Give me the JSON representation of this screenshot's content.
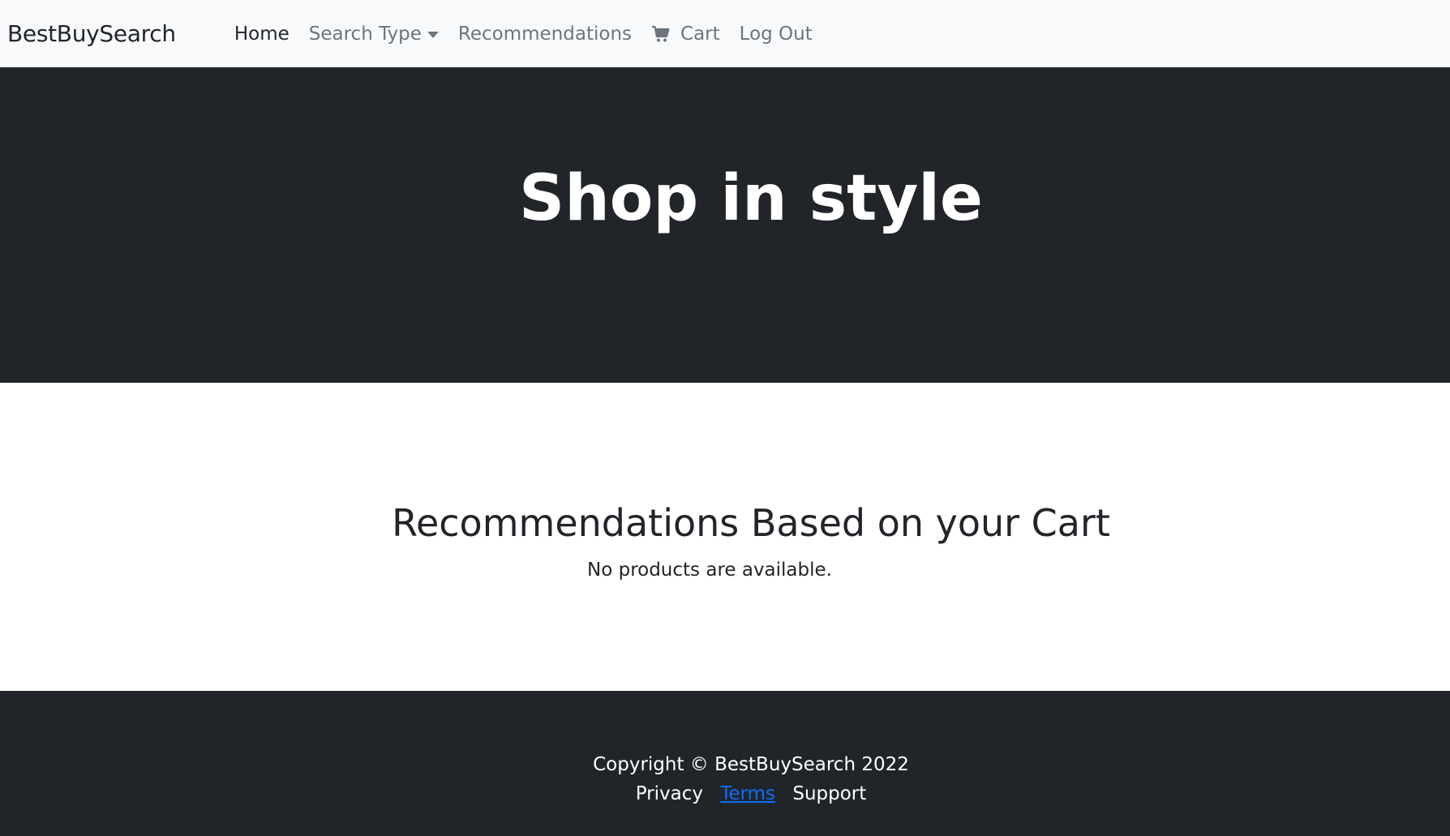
{
  "navbar": {
    "brand": "BestBuySearch",
    "links": {
      "home": "Home",
      "search_type": "Search Type",
      "recommendations": "Recommendations",
      "cart": "Cart",
      "logout": "Log Out"
    },
    "cart_icon": "shopping-cart-icon",
    "dropdown_icon": "caret-down-icon"
  },
  "hero": {
    "title": "Shop in style"
  },
  "main": {
    "heading": "Recommendations Based on your Cart",
    "empty_message": "No products are available."
  },
  "footer": {
    "copyright": "Copyright © BestBuySearch 2022",
    "links": {
      "privacy": "Privacy",
      "terms": "Terms",
      "support": "Support"
    }
  },
  "colors": {
    "navbar_bg": "#f8f9fa",
    "dark_bg": "#212529",
    "link_muted": "#6c757d",
    "link_blue": "#0d6efd"
  }
}
